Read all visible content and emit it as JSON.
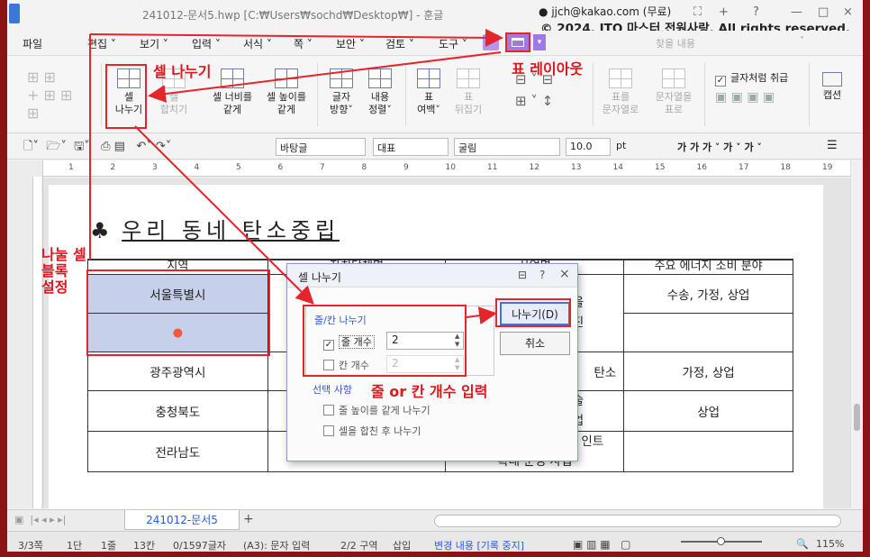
{
  "window": {
    "title": "241012-문서5.hwp [C:₩Users₩sochd₩Desktop₩] - 훈글",
    "user": "jjch@kakao.com (무료)",
    "copyright": "© 2024. ITQ 마스터 전원사랑. All rights reserved.",
    "search_placeholder": "찾을 내용"
  },
  "menu": [
    "파일",
    "편집 ˅",
    "보기 ˅",
    "입력 ˅",
    "서식 ˅",
    "쪽 ˅",
    "보안 ˅",
    "검토 ˅",
    "도구 ˅"
  ],
  "ribbon": {
    "cell_split": "셀\n나누기",
    "cell_merge": "셀\n합치기",
    "equal_width": "셀 너비를\n같게",
    "equal_height": "셀 높이를\n같게",
    "text_dir": "글자\n방향˅",
    "content_align": "내용\n정렬˅",
    "table_margin": "표\n여백˅",
    "table_flip": "표\n뒤집기",
    "to_text": "표를\n문자열로",
    "text_to_table": "문자열을\n표로",
    "treat_as_char": "글자처럼 취급",
    "caption": "캡션"
  },
  "toolbar": {
    "style": "바탕글",
    "font_lang": "대표",
    "font": "굴림",
    "size": "10.0",
    "unit": "pt",
    "fmt": "가 가 가 ˅ 가 ˅ 가 ˅"
  },
  "ruler": [
    "1",
    "2",
    "3",
    "4",
    "5",
    "6",
    "7",
    "8",
    "9",
    "10",
    "11",
    "12",
    "13",
    "14",
    "15",
    "16",
    "17",
    "18",
    "19"
  ],
  "doc": {
    "heading_icon": "♣",
    "heading": "우리 동네 탄소중립",
    "headers": [
      "지역",
      "자치단체명",
      "사업명",
      "주요 에너지 소비 분야"
    ],
    "rows": [
      {
        "region": "서울특별시",
        "bullet": "●",
        "use": "수송, 가정, 상업"
      },
      {
        "region": "광주광역시",
        "use": "가정, 상업"
      },
      {
        "region": "충청북도",
        "use": "상업"
      },
      {
        "region": "전라남도",
        "use": ""
      }
    ],
    "fragments": [
      "착을",
      "추진",
      "원회",
      "탄소",
      "기술",
      "사업",
      "인트",
      "확대 운영 사업"
    ]
  },
  "dialog": {
    "title": "셀 나누기",
    "help": "?",
    "close": "×",
    "group_rc": "줄/칸 나누기",
    "rows_label": "줄 개수",
    "rows_value": "2",
    "cols_label": "칸 개수",
    "cols_value": "2",
    "group_opt": "선택 사항",
    "opt1": "줄 높이를 같게 나누기",
    "opt2": "셀을 합친 후 나누기",
    "ok": "나누기(D)",
    "cancel": "취소"
  },
  "tabs": {
    "doc": "241012-문서5",
    "add": "+"
  },
  "status": [
    "3/3쪽",
    "1단",
    "1줄",
    "13칸",
    "0/1597글자",
    "(A3): 문자 입력",
    "2/2 구역",
    "삽입",
    "변경 내용 [기록 중지]",
    "115%"
  ],
  "annotations": {
    "cell_split": "셀 나누기",
    "table_layout": "표 레이아웃",
    "select_cells": "나눌 셀\n블록\n설정",
    "enter_count": "줄 or 칸 개수 입력"
  },
  "colors": {
    "accent": "#e5242b",
    "selection": "#c7d0ea",
    "frame": "#8a1414"
  }
}
